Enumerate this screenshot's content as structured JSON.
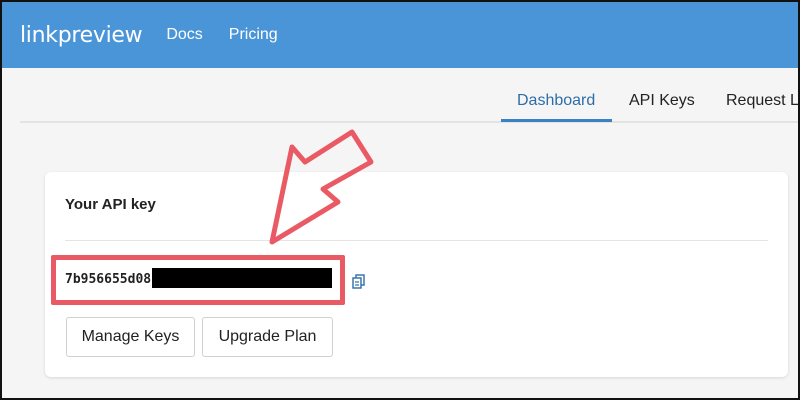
{
  "header": {
    "brand": "linkpreview",
    "nav": [
      "Docs",
      "Pricing"
    ]
  },
  "tabs": [
    {
      "label": "Dashboard",
      "active": true
    },
    {
      "label": "API Keys",
      "active": false
    },
    {
      "label": "Request L",
      "active": false
    }
  ],
  "card": {
    "title": "Your API key",
    "api_key_visible": "7b956655d08",
    "buttons": {
      "manage": "Manage Keys",
      "upgrade": "Upgrade Plan"
    }
  },
  "colors": {
    "header": "#4a95d8",
    "annotation": "#e95a64",
    "active_tab": "#2f6da8"
  },
  "icons": [
    "copy-icon",
    "annotation-arrow"
  ]
}
